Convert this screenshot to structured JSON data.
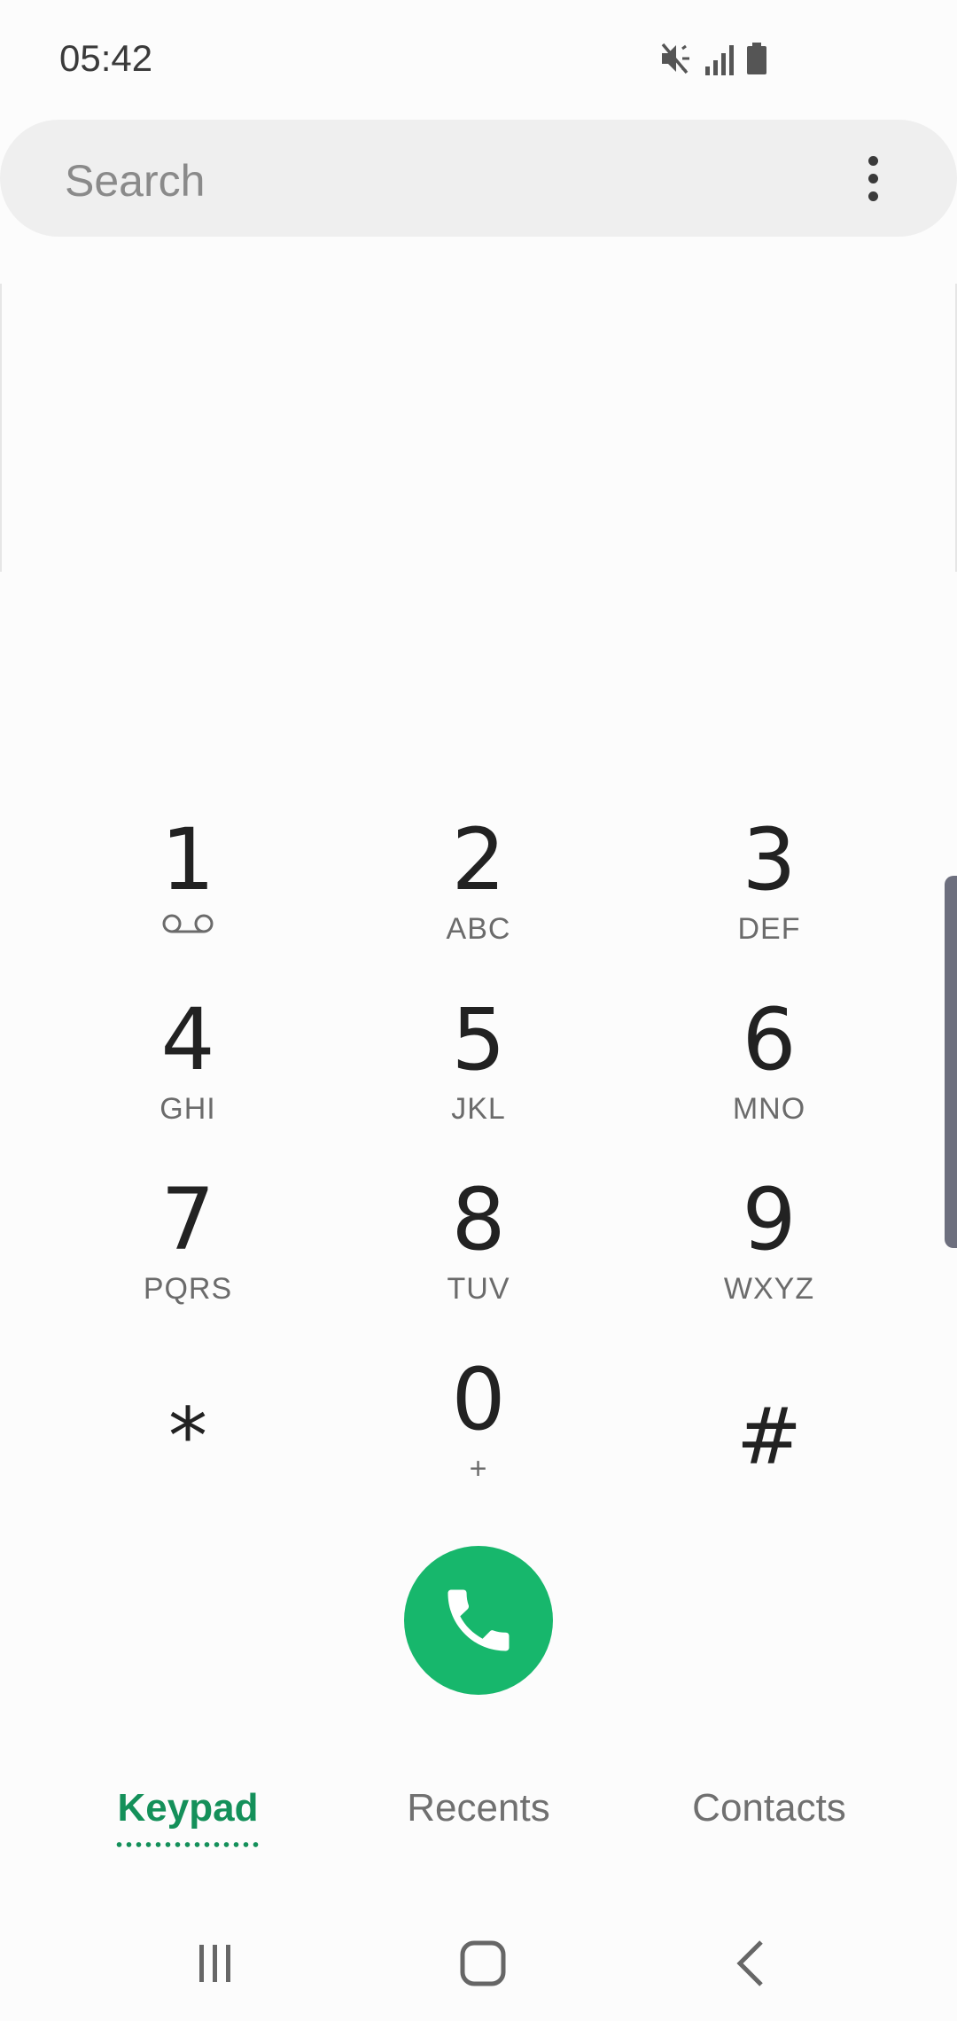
{
  "status_bar": {
    "time": "05:42",
    "icons": [
      "mute-icon",
      "signal-icon",
      "battery-icon"
    ]
  },
  "search": {
    "placeholder": "Search"
  },
  "keypad": {
    "keys": [
      {
        "digit": "1",
        "letters": "",
        "sub_icon": "voicemail-icon"
      },
      {
        "digit": "2",
        "letters": "ABC"
      },
      {
        "digit": "3",
        "letters": "DEF"
      },
      {
        "digit": "4",
        "letters": "GHI"
      },
      {
        "digit": "5",
        "letters": "JKL"
      },
      {
        "digit": "6",
        "letters": "MNO"
      },
      {
        "digit": "7",
        "letters": "PQRS"
      },
      {
        "digit": "8",
        "letters": "TUV"
      },
      {
        "digit": "9",
        "letters": "WXYZ"
      },
      {
        "digit": "*",
        "letters": ""
      },
      {
        "digit": "0",
        "letters": "+"
      },
      {
        "digit": "#",
        "letters": ""
      }
    ]
  },
  "call_button": {
    "icon": "phone-icon",
    "color": "#17b76c"
  },
  "tabs": [
    {
      "label": "Keypad",
      "active": true
    },
    {
      "label": "Recents",
      "active": false
    },
    {
      "label": "Contacts",
      "active": false
    }
  ],
  "colors": {
    "accent": "#14905a",
    "call_green": "#17b76c"
  },
  "nav_bar": {
    "icons": [
      "recent-apps-icon",
      "home-icon",
      "back-icon"
    ]
  }
}
